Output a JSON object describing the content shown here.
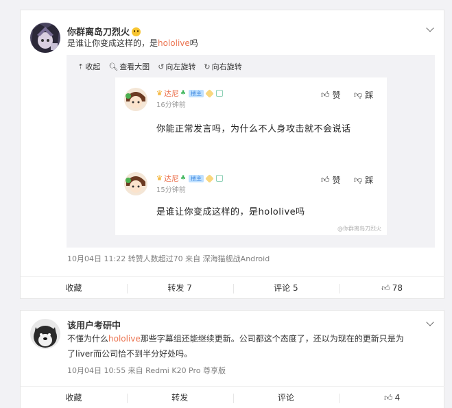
{
  "post1": {
    "username": "你群离岛刀烈火",
    "text_before": "是谁让你变成这样的，是",
    "text_highlight": "hololive",
    "text_after": "吗",
    "toolbar": [
      "收起",
      "查看大图",
      "向左旋转",
      "向右旋转"
    ],
    "image": {
      "comments": [
        {
          "name": "达尼",
          "tag": "楼主",
          "time": "16分钟前",
          "text": "你能正常发言吗，为什么不人身攻击就不会说话",
          "like_label": "赞",
          "dislike_label": "踩"
        },
        {
          "name": "达尼",
          "tag": "楼主",
          "time": "15分钟前",
          "text": "是谁让你变成这样的，是hololive吗",
          "like_label": "赞",
          "dislike_label": "踩"
        }
      ],
      "watermark": "@你群离岛刀烈火"
    },
    "meta": "10月04日 11:22 转赞人数超过70  来自 深海猫舰战Android",
    "actions": {
      "favorite": "收藏",
      "repost": "转发 7",
      "comment": "评论 5",
      "like": "78"
    }
  },
  "post2": {
    "username": "该用户考研中",
    "text_line1_before": "不懂为什么",
    "text_line1_highlight": "hololive",
    "text_line1_after": "那些字幕组还能继续更新。公司都这个态度了，还以为现在的更新只是为",
    "text_line2": "了liver而公司恰不到半分好处吗。",
    "meta": "10月04日 10:55  来自 Redmi K20 Pro 尊享版",
    "actions": {
      "favorite": "收藏",
      "repost": "转发",
      "comment": "评论",
      "like": "4"
    }
  }
}
